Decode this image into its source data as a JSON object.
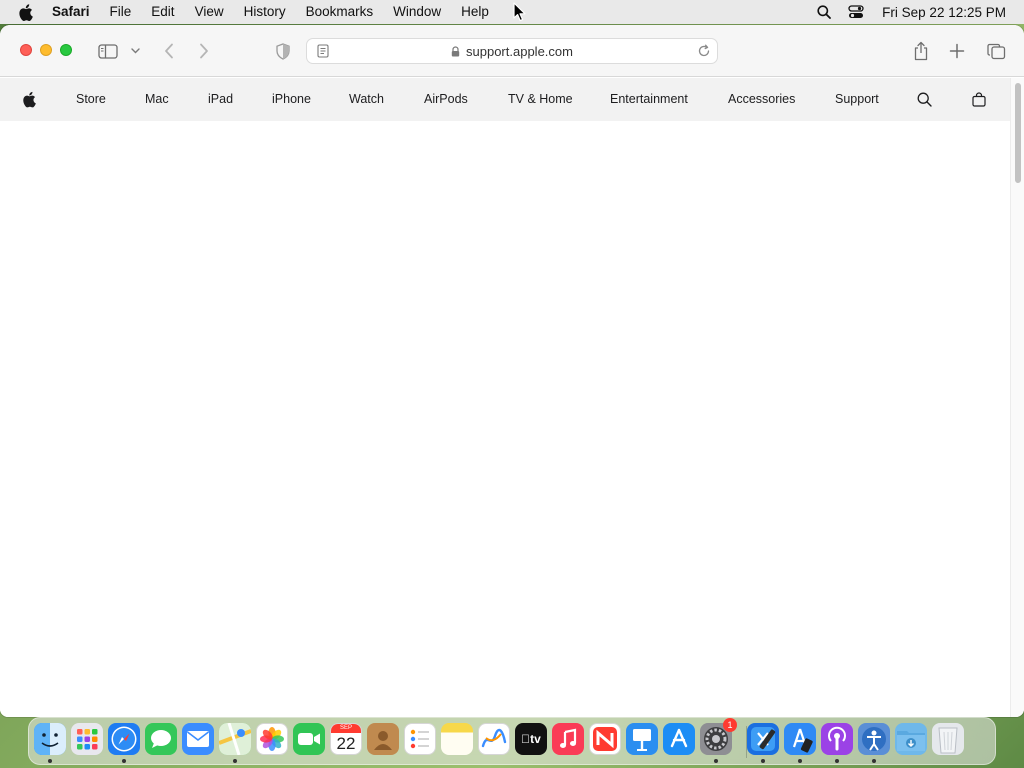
{
  "menubar": {
    "app_name": "Safari",
    "items": [
      "File",
      "Edit",
      "View",
      "History",
      "Bookmarks",
      "Window",
      "Help"
    ],
    "clock": "Fri Sep 22  12:25 PM"
  },
  "safari": {
    "url": "support.apple.com"
  },
  "globalnav": {
    "items": [
      "Store",
      "Mac",
      "iPad",
      "iPhone",
      "Watch",
      "AirPods",
      "TV & Home",
      "Entertainment",
      "Accessories",
      "Support"
    ]
  },
  "dock": {
    "apps": [
      {
        "name": "finder-icon",
        "color": "#2a8cf0",
        "running": true
      },
      {
        "name": "launchpad-icon",
        "color": "#e8e8ee",
        "running": false
      },
      {
        "name": "safari-icon",
        "color": "#1e7cf2",
        "running": true
      },
      {
        "name": "messages-icon",
        "color": "#34c759",
        "running": false
      },
      {
        "name": "mail-icon",
        "color": "#3a8dff",
        "running": false
      },
      {
        "name": "maps-icon",
        "color": "#5cbf5a",
        "running": true
      },
      {
        "name": "photos-icon",
        "color": "#ffffff",
        "running": false
      },
      {
        "name": "facetime-icon",
        "color": "#31c555",
        "running": false
      },
      {
        "name": "calendar-icon",
        "color": "#ffffff",
        "running": false
      },
      {
        "name": "contacts-icon",
        "color": "#c08a4f",
        "running": false
      },
      {
        "name": "reminders-icon",
        "color": "#ffffff",
        "running": false
      },
      {
        "name": "notes-icon",
        "color": "#f7d84a",
        "running": false
      },
      {
        "name": "freeform-icon",
        "color": "#ffffff",
        "running": false
      },
      {
        "name": "tv-icon",
        "color": "#111111",
        "running": false
      },
      {
        "name": "music-icon",
        "color": "#fa3b56",
        "running": false
      },
      {
        "name": "news-icon",
        "color": "#ffffff",
        "running": false
      },
      {
        "name": "keynote-icon",
        "color": "#2b8ef0",
        "running": false
      },
      {
        "name": "app-store-icon",
        "color": "#1c8df5",
        "running": false
      },
      {
        "name": "system-settings-icon",
        "color": "#8e8e93",
        "running": true
      },
      {
        "name": "xcode-icon",
        "color": "#1b6fe0",
        "running": true
      },
      {
        "name": "simulator-icon",
        "color": "#2f8af5",
        "running": true
      },
      {
        "name": "podcasts-icon",
        "color": "#9b42e6",
        "running": true
      },
      {
        "name": "accessibility-inspector-icon",
        "color": "#5a8fd6",
        "running": true
      },
      {
        "name": "downloads-folder-icon",
        "color": "#6fb8ea",
        "running": false
      },
      {
        "name": "trash-icon",
        "color": "#e5e8ec",
        "running": false
      }
    ],
    "calendar": {
      "month": "SEP",
      "day": "22"
    },
    "tv_label": "tv",
    "settings_badge": "1"
  }
}
